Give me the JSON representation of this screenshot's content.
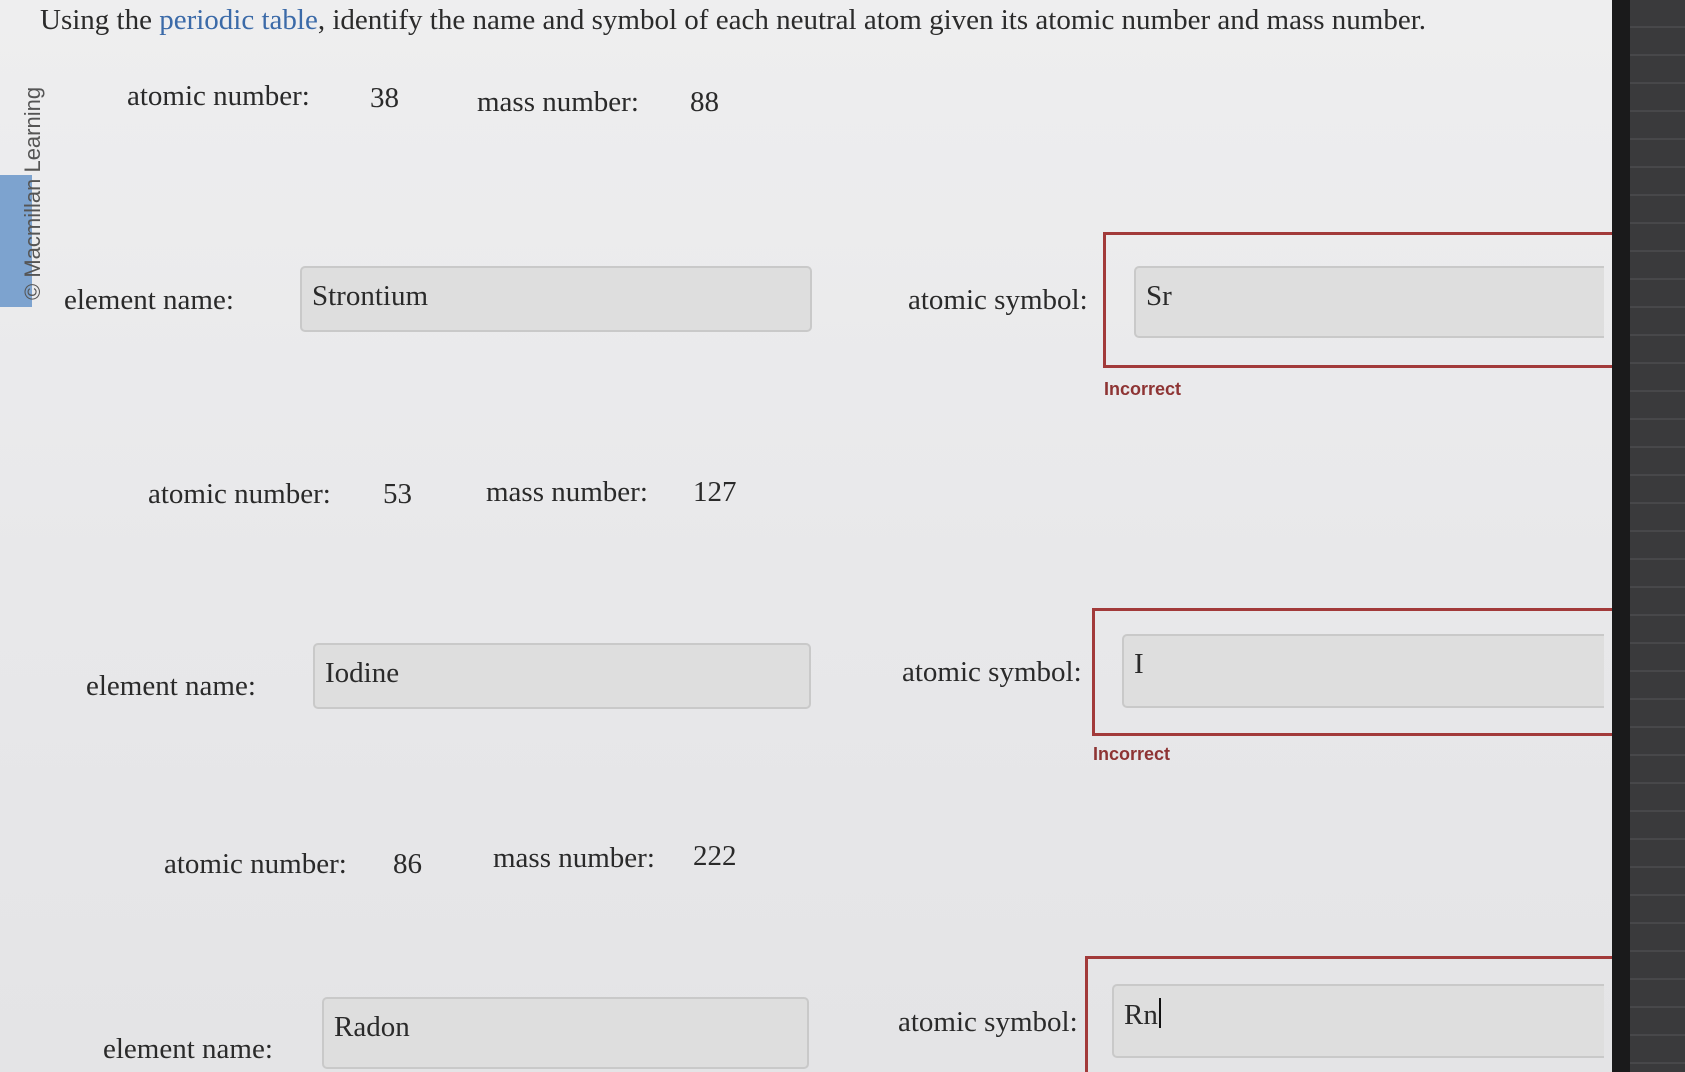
{
  "instruction": {
    "prefix": "Using the ",
    "link": "periodic table",
    "suffix": ", identify the name and symbol of each neutral atom given its atomic number and mass number."
  },
  "copyright": "© Macmillan Learning",
  "labels": {
    "atomic_number": "atomic number:",
    "mass_number": "mass number:",
    "element_name": "element name:",
    "atomic_symbol": "atomic symbol:"
  },
  "problems": [
    {
      "atomic_number": "38",
      "mass_number": "88",
      "element_name": "Strontium",
      "atomic_symbol": "Sr",
      "feedback": "Incorrect"
    },
    {
      "atomic_number": "53",
      "mass_number": "127",
      "element_name": "Iodine",
      "atomic_symbol": "I",
      "feedback": "Incorrect"
    },
    {
      "atomic_number": "86",
      "mass_number": "222",
      "element_name": "Radon",
      "atomic_symbol": "Rn",
      "feedback": ""
    }
  ],
  "colors": {
    "error": "#a23a3a",
    "link": "#3b6aa8"
  }
}
